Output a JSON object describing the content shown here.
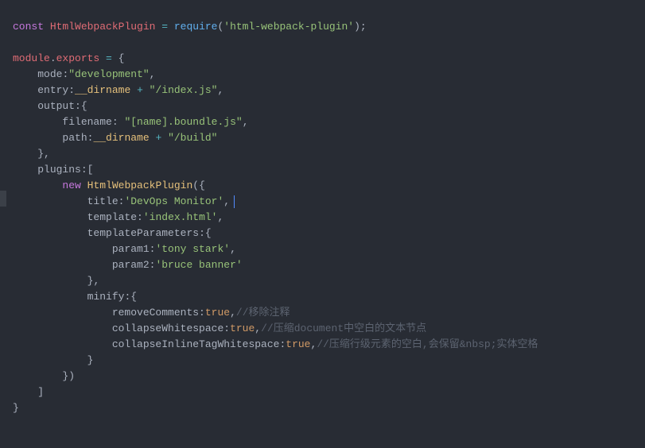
{
  "code": {
    "l1_const": "const",
    "l1_var": "HtmlWebpackPlugin",
    "l1_eq": " = ",
    "l1_req": "require",
    "l1_lp": "(",
    "l1_str": "'html-webpack-plugin'",
    "l1_rp": ")",
    "l1_sc": ";",
    "l3_mod": "module",
    "l3_dot": ".",
    "l3_exp": "exports",
    "l3_eq": " = ",
    "l3_lb": "{",
    "l4_key": "mode",
    "l4_col": ":",
    "l4_val": "\"development\"",
    "l4_c": ",",
    "l5_key": "entry",
    "l5_col": ":",
    "l5_dn": "__dirname",
    "l5_op": " + ",
    "l5_val": "\"/index.js\"",
    "l5_c": ",",
    "l6_key": "output",
    "l6_col": ":",
    "l6_lb": "{",
    "l7_key": "filename",
    "l7_col": ": ",
    "l7_val": "\"[name].boundle.js\"",
    "l7_c": ",",
    "l8_key": "path",
    "l8_col": ":",
    "l8_dn": "__dirname",
    "l8_op": " + ",
    "l8_val": "\"/build\"",
    "l9_rb": "}",
    "l9_c": ",",
    "l10_key": "plugins",
    "l10_col": ":",
    "l10_lb": "[",
    "l11_new": "new",
    "l11_cls": "HtmlWebpackPlugin",
    "l11_lp": "(",
    "l11_lb": "{",
    "l12_key": "title",
    "l12_col": ":",
    "l12_val": "'DevOps Monitor'",
    "l12_c": ",",
    "l13_key": "template",
    "l13_col": ":",
    "l13_val": "'index.html'",
    "l13_c": ",",
    "l14_key": "templateParameters",
    "l14_col": ":",
    "l14_lb": "{",
    "l15_key": "param1",
    "l15_col": ":",
    "l15_val": "'tony stark'",
    "l15_c": ",",
    "l16_key": "param2",
    "l16_col": ":",
    "l16_val": "'bruce banner'",
    "l17_rb": "}",
    "l17_c": ",",
    "l18_key": "minify",
    "l18_col": ":",
    "l18_lb": "{",
    "l19_key": "removeComments",
    "l19_col": ":",
    "l19_val": "true",
    "l19_c": ",",
    "l19_cmt": "//移除注释",
    "l20_key": "collapseWhitespace",
    "l20_col": ":",
    "l20_val": "true",
    "l20_c": ",",
    "l20_cmt": "//压缩document中空白的文本节点",
    "l21_key": "collapseInlineTagWhitespace",
    "l21_col": ":",
    "l21_val": "true",
    "l21_c": ",",
    "l21_cmt": "//压缩行级元素的空白,会保留&nbsp;实体空格",
    "l22_rb": "}",
    "l23_rb": "}",
    "l23_rp": ")",
    "l24_rb": "]",
    "l25_rb": "}"
  }
}
